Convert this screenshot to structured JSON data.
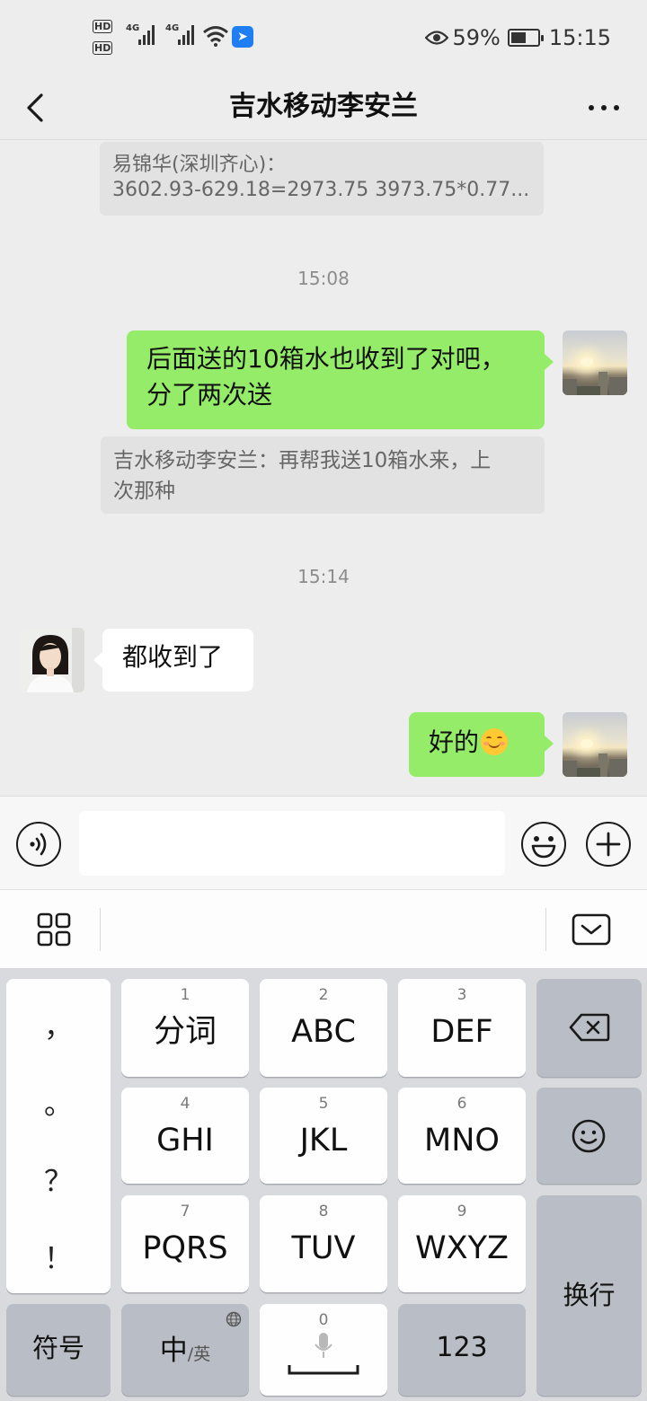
{
  "status_bar": {
    "hd_label": "HD",
    "net1": "4G",
    "net2": "4G",
    "battery_percent": "59%",
    "battery_level": 0.59,
    "time": "15:15"
  },
  "header": {
    "title": "吉水移动李安兰"
  },
  "messages": {
    "quote1_line1": "易锦华(深圳齐心)：",
    "quote1_line2": "3602.93-629.18=2973.75 3973.75*0.77...",
    "time1": "15:08",
    "msg1_line1": "后面送的10箱水也收到了对吧，",
    "msg1_line2": "分了两次送",
    "quote2_line1": "吉水移动李安兰：再帮我送10箱水来，上",
    "quote2_line2": "次那种",
    "time2": "15:14",
    "msg2": "都收到了",
    "msg3": "好的"
  },
  "keyboard": {
    "punct": [
      "，",
      "。",
      "？",
      "！"
    ],
    "keys": [
      {
        "num": "1",
        "label": "分词"
      },
      {
        "num": "2",
        "label": "ABC"
      },
      {
        "num": "3",
        "label": "DEF"
      },
      {
        "num": "4",
        "label": "GHI"
      },
      {
        "num": "5",
        "label": "JKL"
      },
      {
        "num": "6",
        "label": "MNO"
      },
      {
        "num": "7",
        "label": "PQRS"
      },
      {
        "num": "8",
        "label": "TUV"
      },
      {
        "num": "9",
        "label": "WXYZ"
      }
    ],
    "symbol_key": "符号",
    "lang_main": "中",
    "lang_sub": "/英",
    "space_num": "0",
    "num_key": "123",
    "enter_key": "换行"
  },
  "colors": {
    "green_bubble": "#95ec69",
    "background": "#ededed",
    "keyboard_bg": "#d8dade"
  }
}
